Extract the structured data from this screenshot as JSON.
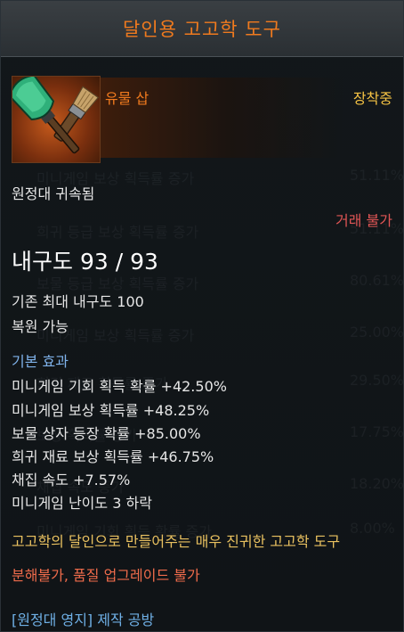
{
  "tooltip": {
    "title": "달인용 고고학 도구",
    "item_name": "유물 삽",
    "equipped_label": "장착중",
    "bound_label": "원정대 귀속됨",
    "trade_label": "거래 불가",
    "durability": "내구도 93 / 93",
    "max_durability": "기존 최대 내구도 100",
    "repairable": "복원 가능",
    "effects_header": "기본 효과",
    "effects": [
      "미니게임 기회 획득 확률 +42.50%",
      "미니게임 보상 획득률 +48.25%",
      "보물 상자 등장 확률 +85.00%",
      "희귀 재료 보상 획득률 +46.75%",
      "채집 속도 +7.57%",
      "미니게임 난이도 3 하락"
    ],
    "flavor": "고고학의 달인으로 만들어주는 매우 진귀한 고고학 도구",
    "restriction": "분해불가, 품질 업그레이드 불가",
    "source": "[원정대 영지] 제작 공방"
  },
  "icons": {
    "item": "shovel-and-brush-icon"
  },
  "colors": {
    "title": "#f07a1e",
    "equipped": "#f6c344",
    "trade": "#e05555",
    "effects_header": "#7fb2ea",
    "flavor": "#e9c160",
    "restriction": "#ef6b4b",
    "source": "#6fb0e6"
  }
}
